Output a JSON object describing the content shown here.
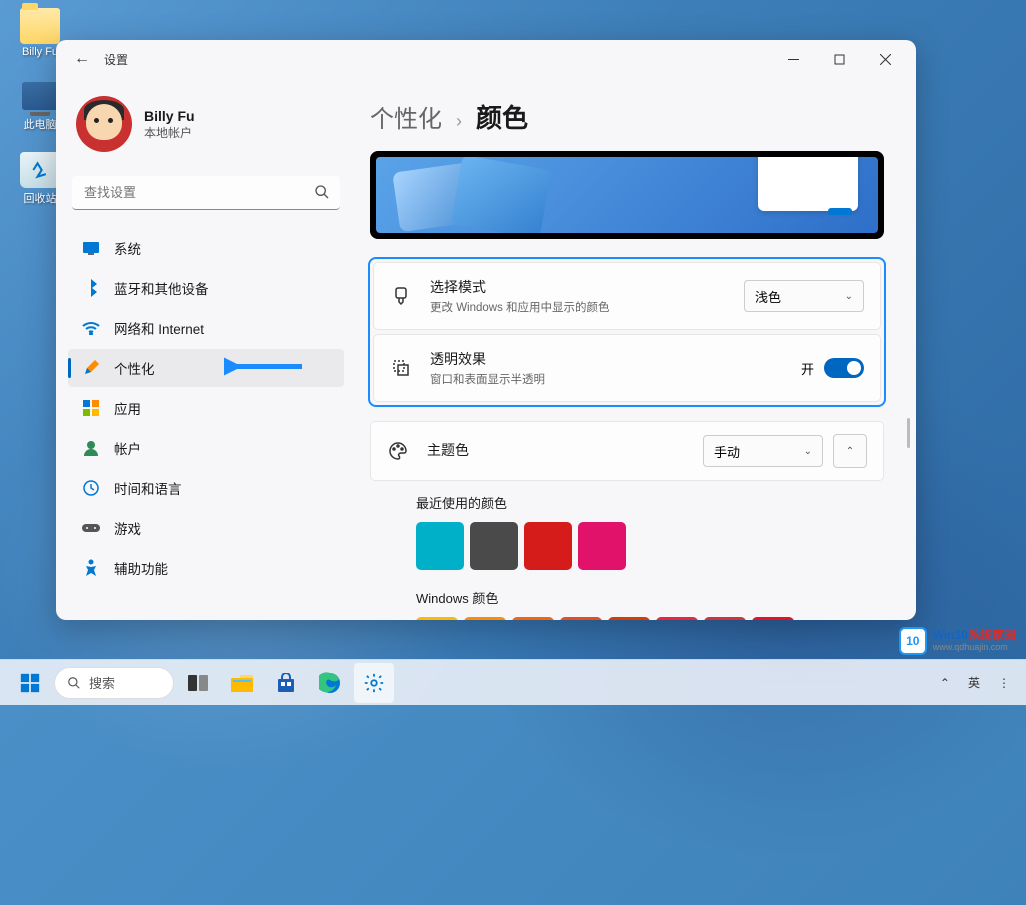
{
  "desktop": {
    "icons": [
      {
        "label": "Billy Fu"
      },
      {
        "label": "此电脑"
      },
      {
        "label": "回收站"
      }
    ]
  },
  "window": {
    "title": "设置",
    "user": {
      "name": "Billy Fu",
      "type": "本地帐户"
    },
    "search": {
      "placeholder": "查找设置"
    },
    "nav": [
      {
        "label": "系统"
      },
      {
        "label": "蓝牙和其他设备"
      },
      {
        "label": "网络和 Internet"
      },
      {
        "label": "个性化"
      },
      {
        "label": "应用"
      },
      {
        "label": "帐户"
      },
      {
        "label": "时间和语言"
      },
      {
        "label": "游戏"
      },
      {
        "label": "辅助功能"
      }
    ],
    "breadcrumb": {
      "parent": "个性化",
      "current": "颜色"
    },
    "mode": {
      "title": "选择模式",
      "desc": "更改 Windows 和应用中显示的颜色",
      "value": "浅色"
    },
    "transparency": {
      "title": "透明效果",
      "desc": "窗口和表面显示半透明",
      "state_label": "开"
    },
    "accent": {
      "title": "主题色",
      "value": "手动"
    },
    "recent_colors": {
      "title": "最近使用的颜色",
      "colors": [
        "#00b0c8",
        "#4a4a4a",
        "#d61b1b",
        "#e0126a"
      ]
    },
    "windows_colors": {
      "title": "Windows 颜色",
      "colors": [
        "#ffb900",
        "#ff8c00",
        "#f7630c",
        "#e84d20",
        "#da3b01",
        "#ef233c",
        "#d13438",
        "#e81123"
      ]
    }
  },
  "taskbar": {
    "search_label": "搜索",
    "ime": "英"
  },
  "watermark": {
    "badge": "10",
    "title_a": "Win10",
    "title_b": "系统家园",
    "url": "www.qdhuajin.com"
  }
}
